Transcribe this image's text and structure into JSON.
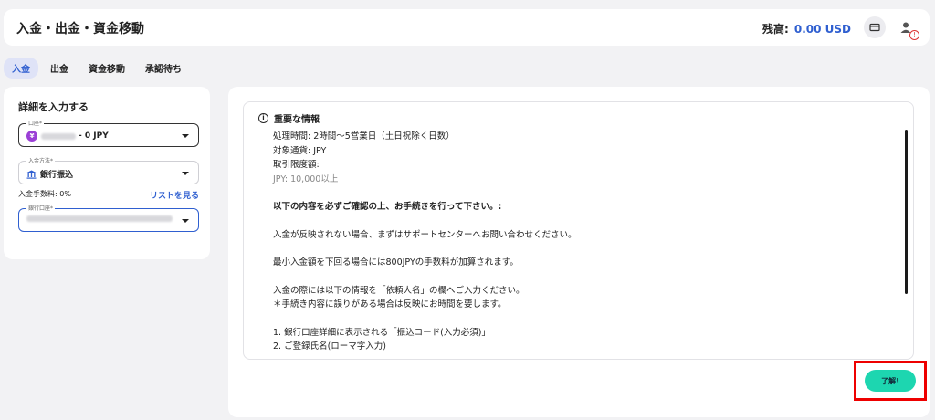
{
  "header": {
    "title": "入金・出金・資金移動",
    "balance_label": "残高:",
    "balance_value": "0.00 USD"
  },
  "tabs": [
    {
      "label": "入金",
      "active": true
    },
    {
      "label": "出金",
      "active": false
    },
    {
      "label": "資金移動",
      "active": false
    },
    {
      "label": "承認待ち",
      "active": false
    }
  ],
  "form": {
    "title": "詳細を入力する",
    "account": {
      "label": "口座*",
      "value": "- 0 JPY"
    },
    "method": {
      "label": "入金方法*",
      "value": "銀行振込"
    },
    "fee_label": "入金手数料: 0%",
    "list_link": "リストを見る",
    "bank_account": {
      "label": "銀行口座*"
    }
  },
  "notice": {
    "title": "重要な情報",
    "lines": [
      "処理時間: 2時間〜5営業日（土日祝除く日数）",
      "対象通貨: JPY",
      "取引限度額:",
      "JPY: 10,000以上",
      "以下の内容を必ずご確認の上、お手続きを行って下さい。:",
      "入金が反映されない場合、まずはサポートセンターへお問い合わせください。",
      "最小入金額を下回る場合には800JPYの手数料が加算されます。",
      "入金の際には以下の情報を「依頼人名」の欄へご入力ください。",
      "＊手続き内容に誤りがある場合は反映にお時間を要します。",
      "1. 銀行口座詳細に表示される「振込コード(入力必須)」",
      "2. ご登録氏名(ローマ字入力)"
    ]
  },
  "ok_button": "了解!",
  "colors": {
    "accent": "#2f5fd0",
    "ok": "#1dd6b0",
    "highlight": "#e00000"
  }
}
